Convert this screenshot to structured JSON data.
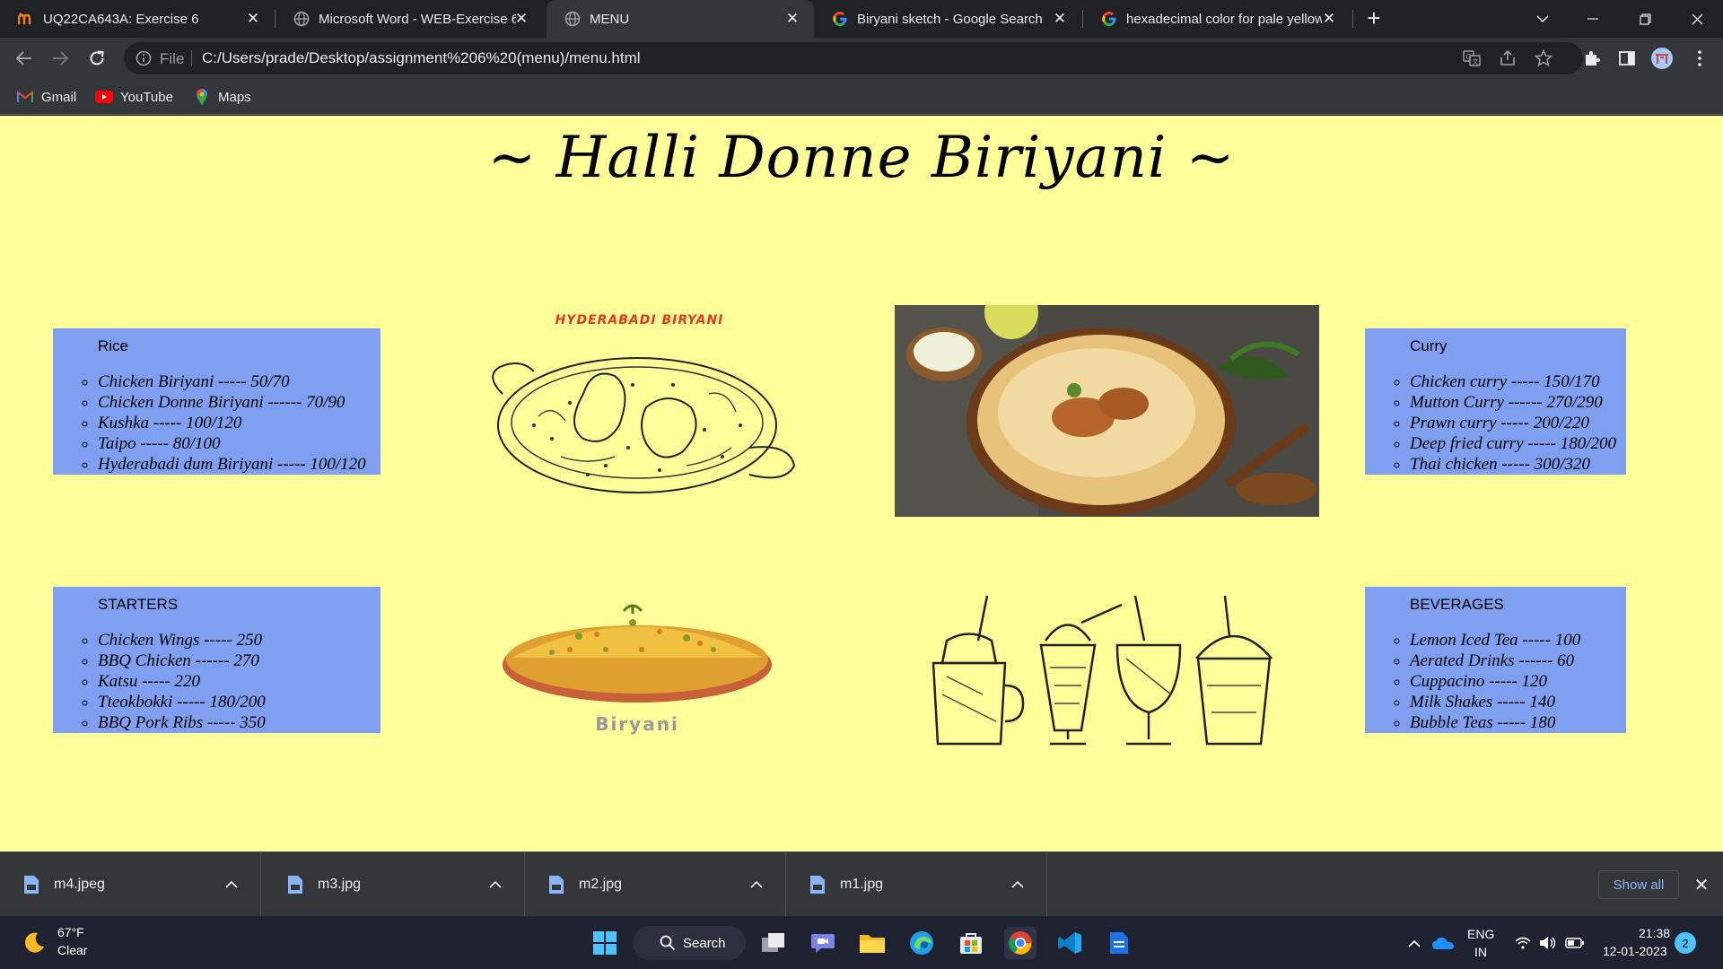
{
  "browser": {
    "tabs": [
      {
        "title": "UQ22CA643A: Exercise 6",
        "active": false
      },
      {
        "title": "Microsoft Word - WEB-Exercise 6",
        "active": false
      },
      {
        "title": "MENU",
        "active": true
      },
      {
        "title": "Biryani sketch - Google Search",
        "active": false
      },
      {
        "title": "hexadecimal color for pale yellow",
        "active": false
      }
    ],
    "address": {
      "scheme": "File",
      "url": "C:/Users/prade/Desktop/assignment%206%20(menu)/menu.html"
    },
    "bookmarks": [
      {
        "label": "Gmail",
        "icon": "gmail-icon"
      },
      {
        "label": "YouTube",
        "icon": "youtube-icon"
      },
      {
        "label": "Maps",
        "icon": "maps-icon"
      }
    ]
  },
  "page": {
    "title": "~ Halli Donne Biriyani ~",
    "background": "#ffff99",
    "box_color": "#7f9ff0",
    "sections": {
      "rice": {
        "heading": "Rice",
        "items": [
          "Chicken Biriyani ----- 50/70",
          "Chicken Donne Biriyani ------ 70/90",
          "Kushka ----- 100/120",
          "Taipo ----- 80/100",
          "Hyderabadi dum Biriyani ----- 100/120"
        ]
      },
      "curry": {
        "heading": "Curry",
        "items": [
          "Chicken curry ----- 150/170",
          "Mutton Curry ------ 270/290",
          "Prawn curry ----- 200/220",
          "Deep fried curry ----- 180/200",
          "Thai chicken ----- 300/320"
        ]
      },
      "starters": {
        "heading": "STARTERS",
        "items": [
          "Chicken Wings ----- 250",
          "BBQ Chicken ------ 270",
          "Katsu ----- 220",
          "Tteokbokki ----- 180/200",
          "BBQ Pork Ribs ----- 350"
        ]
      },
      "beverages": {
        "heading": "BEVERAGES",
        "items": [
          "Lemon Iced Tea ----- 100",
          "Aerated Drinks ------ 60",
          "Cuppacino ----- 120",
          "Milk Shakes ----- 140",
          "Bubble Teas ----- 180"
        ]
      }
    },
    "images": {
      "sketch_caption": "HYDERABADI BIRYANI",
      "plate_caption": "Biryani"
    }
  },
  "downloads": {
    "items": [
      "m4.jpeg",
      "m3.jpg",
      "m2.jpg",
      "m1.jpg"
    ],
    "show_all": "Show all"
  },
  "taskbar": {
    "weather_temp": "67°F",
    "weather_cond": "Clear",
    "search_label": "Search",
    "language": "ENG",
    "region": "IN",
    "time": "21:38",
    "date": "12-01-2023",
    "notifications": "2"
  }
}
